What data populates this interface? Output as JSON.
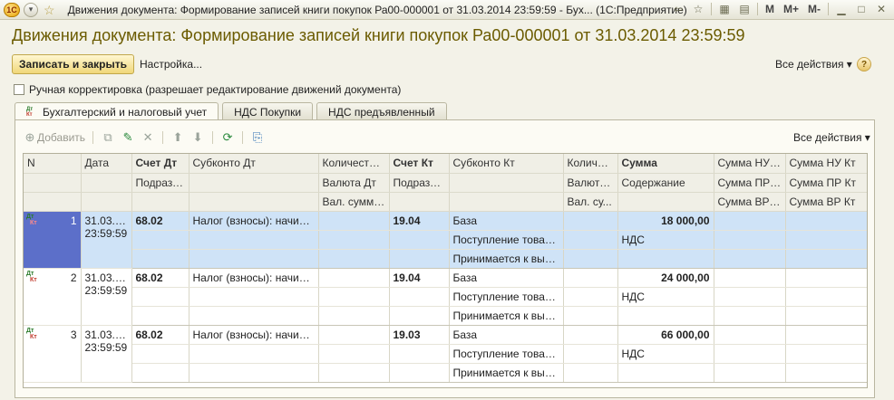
{
  "titlebar": {
    "logo": "1С",
    "title": "Движения документа: Формирование записей книги покупок Ра00-000001 от 31.03.2014 23:59:59 - Бух...   (1С:Предприятие)",
    "icons": [
      "back-icon",
      "star-icon",
      "calculator-icon",
      "calendar-icon"
    ],
    "memory": [
      "M",
      "M+",
      "M-"
    ],
    "window_buttons": [
      "minimize-icon",
      "maximize-icon",
      "close-icon"
    ]
  },
  "header": {
    "title": "Движения документа: Формирование записей книги покупок Ра00-000001 от 31.03.2014 23:59:59",
    "save_close_label": "Записать и закрыть",
    "settings_label": "Настройка...",
    "all_actions_label": "Все действия ▾",
    "help_label": "?"
  },
  "manual_correction": {
    "label": "Ручная корректировка (разрешает редактирование движений документа)",
    "checked": false
  },
  "tabs": [
    {
      "label": "Бухгалтерский и налоговый учет",
      "active": true
    },
    {
      "label": "НДС Покупки",
      "active": false
    },
    {
      "label": "НДС предъявленный",
      "active": false
    }
  ],
  "toolbar": {
    "add_label": "Добавить",
    "all_actions_label": "Все действия ▾"
  },
  "grid": {
    "header_row1": [
      "N",
      "Дата",
      "Счет Дт",
      "Субконто Дт",
      "Количество...",
      "Счет Кт",
      "Субконто Кт",
      "Количес...",
      "Сумма",
      "Сумма НУ Дт",
      "Сумма НУ Кт"
    ],
    "header_row2": [
      "",
      "",
      "Подразд...",
      "",
      "Валюта Дт",
      "Подразд...",
      "",
      "Валюта Кт",
      "Содержание",
      "Сумма ПР Дт",
      "Сумма ПР Кт"
    ],
    "header_row3": [
      "",
      "",
      "",
      "",
      "Вал. сумма ...",
      "",
      "",
      "Вал. су...",
      "",
      "Сумма ВР Дт",
      "Сумма ВР Кт"
    ],
    "rows": [
      {
        "n": "1",
        "date": "31.03.2...",
        "time": "23:59:59",
        "account_dt": "68.02",
        "subconto_dt": "Налог (взносы): начисле...",
        "account_kt": "19.04",
        "subconto_kt": [
          "База",
          "Поступление товаро...",
          "Принимается к вычету"
        ],
        "amount": "18 000,00",
        "content": "НДС",
        "selected": true
      },
      {
        "n": "2",
        "date": "31.03.2...",
        "time": "23:59:59",
        "account_dt": "68.02",
        "subconto_dt": "Налог (взносы): начисле...",
        "account_kt": "19.04",
        "subconto_kt": [
          "База",
          "Поступление товаро...",
          "Принимается к вычету"
        ],
        "amount": "24 000,00",
        "content": "НДС",
        "selected": false
      },
      {
        "n": "3",
        "date": "31.03.2...",
        "time": "23:59:59",
        "account_dt": "68.02",
        "subconto_dt": "Налог (взносы): начисле...",
        "account_kt": "19.03",
        "subconto_kt": [
          "База",
          "Поступление товаро...",
          "Принимается к вычету"
        ],
        "amount": "66 000,00",
        "content": "НДС",
        "selected": false
      }
    ],
    "row_icon": {
      "dt": "Дт",
      "kt": "Кт"
    }
  },
  "colors": {
    "title_text": "#6b5b00",
    "selection": "#cfe3f7",
    "selected_number_cell": "#5c6fc9",
    "save_button": "#f0d779"
  }
}
